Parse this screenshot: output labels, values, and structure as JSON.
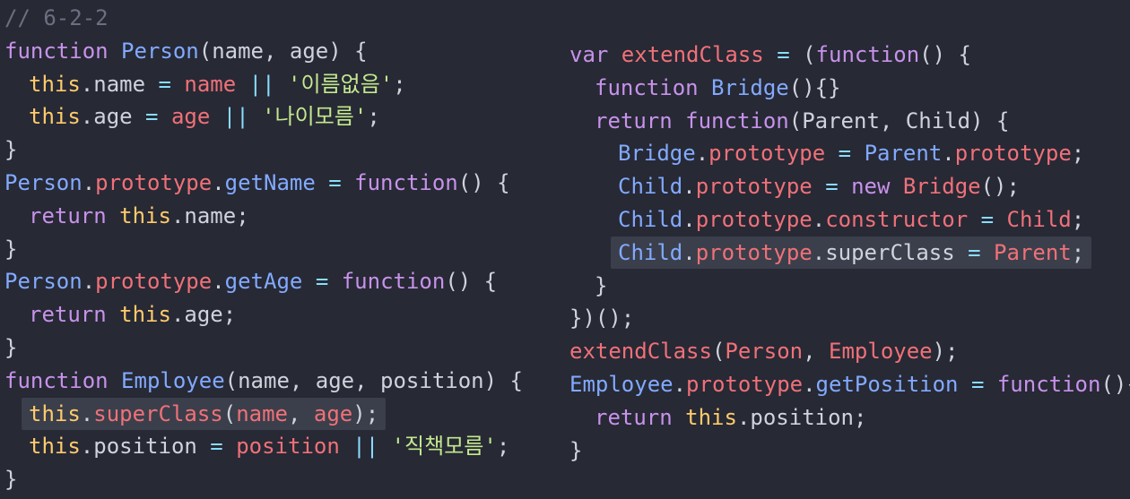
{
  "code": {
    "left": [
      {
        "indent": 0,
        "tokens": [
          {
            "t": "// 6-2-2",
            "c": "comment"
          }
        ]
      },
      {
        "indent": 0,
        "tokens": [
          {
            "t": "function ",
            "c": "kw"
          },
          {
            "t": "Person",
            "c": "fn"
          },
          {
            "t": "(name, age) {",
            "c": "plain"
          }
        ]
      },
      {
        "indent": 1,
        "tokens": [
          {
            "t": "this",
            "c": "this"
          },
          {
            "t": ".name ",
            "c": "plain"
          },
          {
            "t": "= ",
            "c": "op"
          },
          {
            "t": "name ",
            "c": "prop"
          },
          {
            "t": "|| ",
            "c": "op"
          },
          {
            "t": "'이름없음'",
            "c": "str"
          },
          {
            "t": ";",
            "c": "plain"
          }
        ]
      },
      {
        "indent": 1,
        "tokens": [
          {
            "t": "this",
            "c": "this"
          },
          {
            "t": ".age ",
            "c": "plain"
          },
          {
            "t": "= ",
            "c": "op"
          },
          {
            "t": "age ",
            "c": "prop"
          },
          {
            "t": "|| ",
            "c": "op"
          },
          {
            "t": "'나이모름'",
            "c": "str"
          },
          {
            "t": ";",
            "c": "plain"
          }
        ]
      },
      {
        "indent": 0,
        "tokens": [
          {
            "t": "}",
            "c": "plain"
          }
        ]
      },
      {
        "indent": 0,
        "tokens": [
          {
            "t": "Person",
            "c": "fn"
          },
          {
            "t": ".",
            "c": "plain"
          },
          {
            "t": "prototype",
            "c": "prop"
          },
          {
            "t": ".",
            "c": "plain"
          },
          {
            "t": "getName ",
            "c": "fn"
          },
          {
            "t": "= ",
            "c": "op"
          },
          {
            "t": "function",
            "c": "kw"
          },
          {
            "t": "() {",
            "c": "plain"
          }
        ]
      },
      {
        "indent": 1,
        "tokens": [
          {
            "t": "return ",
            "c": "kw"
          },
          {
            "t": "this",
            "c": "this"
          },
          {
            "t": ".name;",
            "c": "plain"
          }
        ]
      },
      {
        "indent": 0,
        "tokens": [
          {
            "t": "}",
            "c": "plain"
          }
        ]
      },
      {
        "indent": 0,
        "tokens": [
          {
            "t": "Person",
            "c": "fn"
          },
          {
            "t": ".",
            "c": "plain"
          },
          {
            "t": "prototype",
            "c": "prop"
          },
          {
            "t": ".",
            "c": "plain"
          },
          {
            "t": "getAge ",
            "c": "fn"
          },
          {
            "t": "= ",
            "c": "op"
          },
          {
            "t": "function",
            "c": "kw"
          },
          {
            "t": "() {",
            "c": "plain"
          }
        ]
      },
      {
        "indent": 1,
        "tokens": [
          {
            "t": "return ",
            "c": "kw"
          },
          {
            "t": "this",
            "c": "this"
          },
          {
            "t": ".age;",
            "c": "plain"
          }
        ]
      },
      {
        "indent": 0,
        "tokens": [
          {
            "t": "}",
            "c": "plain"
          }
        ]
      },
      {
        "indent": 0,
        "tokens": [
          {
            "t": "function ",
            "c": "kw"
          },
          {
            "t": "Employee",
            "c": "fn"
          },
          {
            "t": "(name, age, position) {",
            "c": "plain"
          }
        ]
      },
      {
        "indent": 1,
        "highlight": true,
        "tokens": [
          {
            "t": "this",
            "c": "this"
          },
          {
            "t": ".",
            "c": "plain"
          },
          {
            "t": "superClass",
            "c": "prop"
          },
          {
            "t": "(",
            "c": "plain"
          },
          {
            "t": "name",
            "c": "prop"
          },
          {
            "t": ", ",
            "c": "plain"
          },
          {
            "t": "age",
            "c": "prop"
          },
          {
            "t": ");",
            "c": "plain"
          }
        ]
      },
      {
        "indent": 1,
        "tokens": [
          {
            "t": "this",
            "c": "this"
          },
          {
            "t": ".position ",
            "c": "plain"
          },
          {
            "t": "= ",
            "c": "op"
          },
          {
            "t": "position ",
            "c": "prop"
          },
          {
            "t": "|| ",
            "c": "op"
          },
          {
            "t": "'직책모름'",
            "c": "str"
          },
          {
            "t": ";",
            "c": "plain"
          }
        ]
      },
      {
        "indent": 0,
        "tokens": [
          {
            "t": "}",
            "c": "plain"
          }
        ]
      }
    ],
    "right": [
      {
        "indent": 0,
        "tokens": [
          {
            "t": "var ",
            "c": "kw"
          },
          {
            "t": "extendClass ",
            "c": "prop"
          },
          {
            "t": "= ",
            "c": "op"
          },
          {
            "t": "(",
            "c": "plain"
          },
          {
            "t": "function",
            "c": "kw"
          },
          {
            "t": "() {",
            "c": "plain"
          }
        ]
      },
      {
        "indent": 1,
        "tokens": [
          {
            "t": "function ",
            "c": "kw"
          },
          {
            "t": "Bridge",
            "c": "fn"
          },
          {
            "t": "(){}",
            "c": "plain"
          }
        ]
      },
      {
        "indent": 1,
        "tokens": [
          {
            "t": "return ",
            "c": "kw"
          },
          {
            "t": "function",
            "c": "kw"
          },
          {
            "t": "(Parent, Child) {",
            "c": "plain"
          }
        ]
      },
      {
        "indent": 2,
        "tokens": [
          {
            "t": "Bridge",
            "c": "fn"
          },
          {
            "t": ".",
            "c": "plain"
          },
          {
            "t": "prototype ",
            "c": "prop"
          },
          {
            "t": "= ",
            "c": "op"
          },
          {
            "t": "Parent",
            "c": "fn"
          },
          {
            "t": ".",
            "c": "plain"
          },
          {
            "t": "prototype",
            "c": "prop"
          },
          {
            "t": ";",
            "c": "plain"
          }
        ]
      },
      {
        "indent": 2,
        "tokens": [
          {
            "t": "Child",
            "c": "fn"
          },
          {
            "t": ".",
            "c": "plain"
          },
          {
            "t": "prototype ",
            "c": "prop"
          },
          {
            "t": "= ",
            "c": "op"
          },
          {
            "t": "new ",
            "c": "kw"
          },
          {
            "t": "Bridge",
            "c": "prop"
          },
          {
            "t": "();",
            "c": "plain"
          }
        ]
      },
      {
        "indent": 2,
        "tokens": [
          {
            "t": "Child",
            "c": "fn"
          },
          {
            "t": ".",
            "c": "plain"
          },
          {
            "t": "prototype",
            "c": "prop"
          },
          {
            "t": ".",
            "c": "plain"
          },
          {
            "t": "constructor ",
            "c": "prop"
          },
          {
            "t": "= ",
            "c": "op"
          },
          {
            "t": "Child",
            "c": "prop"
          },
          {
            "t": ";",
            "c": "plain"
          }
        ]
      },
      {
        "indent": 2,
        "highlight": true,
        "tokens": [
          {
            "t": "Child",
            "c": "fn"
          },
          {
            "t": ".",
            "c": "plain"
          },
          {
            "t": "prototype",
            "c": "prop"
          },
          {
            "t": ".superClass ",
            "c": "plain"
          },
          {
            "t": "= ",
            "c": "op"
          },
          {
            "t": "Parent",
            "c": "prop"
          },
          {
            "t": ";",
            "c": "plain"
          }
        ]
      },
      {
        "indent": 1,
        "tokens": [
          {
            "t": "}",
            "c": "plain"
          }
        ]
      },
      {
        "indent": 0,
        "tokens": [
          {
            "t": "})();",
            "c": "plain"
          }
        ]
      },
      {
        "indent": 0,
        "tokens": [
          {
            "t": "extendClass",
            "c": "prop"
          },
          {
            "t": "(",
            "c": "plain"
          },
          {
            "t": "Person",
            "c": "prop"
          },
          {
            "t": ", ",
            "c": "plain"
          },
          {
            "t": "Employee",
            "c": "prop"
          },
          {
            "t": ");",
            "c": "plain"
          }
        ]
      },
      {
        "indent": 0,
        "tokens": [
          {
            "t": "Employee",
            "c": "fn"
          },
          {
            "t": ".",
            "c": "plain"
          },
          {
            "t": "prototype",
            "c": "prop"
          },
          {
            "t": ".",
            "c": "plain"
          },
          {
            "t": "getPosition ",
            "c": "fn"
          },
          {
            "t": "= ",
            "c": "op"
          },
          {
            "t": "function",
            "c": "kw"
          },
          {
            "t": "(){",
            "c": "plain"
          }
        ]
      },
      {
        "indent": 1,
        "tokens": [
          {
            "t": "return ",
            "c": "kw"
          },
          {
            "t": "this",
            "c": "this"
          },
          {
            "t": ".position;",
            "c": "plain"
          }
        ]
      },
      {
        "indent": 0,
        "tokens": [
          {
            "t": "}",
            "c": "plain"
          }
        ]
      }
    ]
  },
  "theme": {
    "background": "#272935",
    "highlight": "#3b3f4b"
  }
}
